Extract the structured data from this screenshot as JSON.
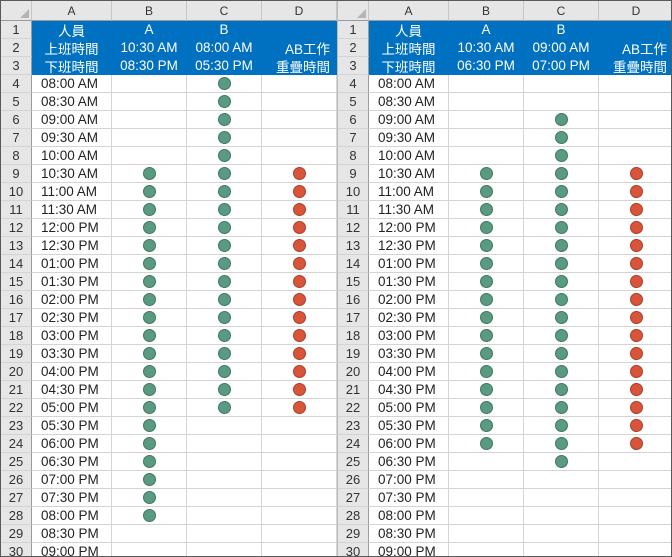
{
  "colors": {
    "header_fill": "#0070c0",
    "header_text": "#ffffff",
    "on_duty": "#5a9a80",
    "overlap": "#d8543a",
    "headings_bg": "#e6e6e6"
  },
  "icons": {
    "on_duty": "green-circle-icon",
    "overlap": "red-circle-icon"
  },
  "column_headers": [
    "A",
    "B",
    "C",
    "D"
  ],
  "row_numbers": [
    "1",
    "2",
    "3",
    "4",
    "5",
    "6",
    "7",
    "8",
    "9",
    "10",
    "11",
    "12",
    "13",
    "14",
    "15",
    "16",
    "17",
    "18",
    "19",
    "20",
    "21",
    "22",
    "23",
    "24",
    "25",
    "26",
    "27",
    "28",
    "29",
    "30"
  ],
  "times": [
    "08:00 AM",
    "08:30 AM",
    "09:00 AM",
    "09:30 AM",
    "10:00 AM",
    "10:30 AM",
    "11:00 AM",
    "11:30 AM",
    "12:00 PM",
    "12:30 PM",
    "01:00 PM",
    "01:30 PM",
    "02:00 PM",
    "02:30 PM",
    "03:00 PM",
    "03:30 PM",
    "04:00 PM",
    "04:30 PM",
    "05:00 PM",
    "05:30 PM",
    "06:00 PM",
    "06:30 PM",
    "07:00 PM",
    "07:30 PM",
    "08:00 PM",
    "08:30 PM",
    "09:00 PM"
  ],
  "sheets": [
    {
      "header_rows": [
        [
          "人員",
          "A",
          "B",
          ""
        ],
        [
          "上班時間",
          "10:30 AM",
          "08:00 AM",
          "AB工作"
        ],
        [
          "下班時間",
          "08:30 PM",
          "05:30 PM",
          "重疊時間"
        ]
      ],
      "marks": {
        "A": [
          0,
          0,
          0,
          0,
          0,
          1,
          1,
          1,
          1,
          1,
          1,
          1,
          1,
          1,
          1,
          1,
          1,
          1,
          1,
          1,
          1,
          1,
          1,
          1,
          1,
          0,
          0
        ],
        "B": [
          1,
          1,
          1,
          1,
          1,
          1,
          1,
          1,
          1,
          1,
          1,
          1,
          1,
          1,
          1,
          1,
          1,
          1,
          1,
          0,
          0,
          0,
          0,
          0,
          0,
          0,
          0
        ],
        "overlap": [
          0,
          0,
          0,
          0,
          0,
          1,
          1,
          1,
          1,
          1,
          1,
          1,
          1,
          1,
          1,
          1,
          1,
          1,
          1,
          0,
          0,
          0,
          0,
          0,
          0,
          0,
          0
        ]
      }
    },
    {
      "header_rows": [
        [
          "人員",
          "A",
          "B",
          ""
        ],
        [
          "上班時間",
          "10:30 AM",
          "09:00 AM",
          "AB工作"
        ],
        [
          "下班時間",
          "06:30 PM",
          "07:00 PM",
          "重疊時間"
        ]
      ],
      "marks": {
        "A": [
          0,
          0,
          0,
          0,
          0,
          1,
          1,
          1,
          1,
          1,
          1,
          1,
          1,
          1,
          1,
          1,
          1,
          1,
          1,
          1,
          1,
          0,
          0,
          0,
          0,
          0,
          0
        ],
        "B": [
          0,
          0,
          1,
          1,
          1,
          1,
          1,
          1,
          1,
          1,
          1,
          1,
          1,
          1,
          1,
          1,
          1,
          1,
          1,
          1,
          1,
          1,
          0,
          0,
          0,
          0,
          0
        ],
        "overlap": [
          0,
          0,
          0,
          0,
          0,
          1,
          1,
          1,
          1,
          1,
          1,
          1,
          1,
          1,
          1,
          1,
          1,
          1,
          1,
          1,
          1,
          0,
          0,
          0,
          0,
          0,
          0
        ]
      }
    }
  ]
}
